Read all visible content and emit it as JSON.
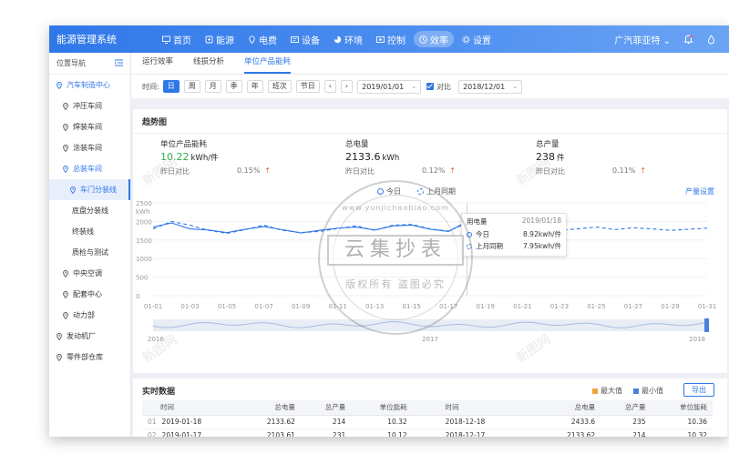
{
  "app": {
    "title": "能源管理系统",
    "nav": [
      {
        "label": "首页",
        "icon": "monitor-icon"
      },
      {
        "label": "能源",
        "icon": "energy-icon"
      },
      {
        "label": "电费",
        "icon": "location-icon"
      },
      {
        "label": "设备",
        "icon": "device-icon"
      },
      {
        "label": "环境",
        "icon": "pie-icon"
      },
      {
        "label": "控制",
        "icon": "control-icon"
      },
      {
        "label": "效率",
        "icon": "clock-icon"
      },
      {
        "label": "设置",
        "icon": "gear-icon"
      }
    ],
    "active_nav": "效率",
    "user": "广汽菲亚特"
  },
  "sidebar": {
    "title": "位置导航",
    "items": [
      {
        "label": "汽车制造中心",
        "level": "l0",
        "state": "blue"
      },
      {
        "label": "冲压车间",
        "level": "l1",
        "state": ""
      },
      {
        "label": "焊装车间",
        "level": "l1",
        "state": ""
      },
      {
        "label": "涂装车间",
        "level": "l1",
        "state": ""
      },
      {
        "label": "总装车间",
        "level": "l1",
        "state": "blue"
      },
      {
        "label": "车门分装线",
        "level": "l2",
        "state": "selected"
      },
      {
        "label": "底盘分装线",
        "level": "leaf",
        "state": ""
      },
      {
        "label": "终装线",
        "level": "leaf",
        "state": ""
      },
      {
        "label": "质检与测试",
        "level": "leaf",
        "state": ""
      },
      {
        "label": "中央空调",
        "level": "l1",
        "state": ""
      },
      {
        "label": "配套中心",
        "level": "l1",
        "state": ""
      },
      {
        "label": "动力部",
        "level": "l1",
        "state": ""
      },
      {
        "label": "发动机厂",
        "level": "l0",
        "state": ""
      },
      {
        "label": "零件部仓库",
        "level": "l0",
        "state": ""
      }
    ]
  },
  "tabs": [
    "运行效率",
    "线损分析",
    "单位产品能耗"
  ],
  "active_tab": "单位产品能耗",
  "filter": {
    "label": "时间:",
    "periods": [
      "日",
      "周",
      "月",
      "季",
      "年",
      "班次",
      "节日"
    ],
    "active_period": "日",
    "prev": "‹",
    "next": "›",
    "date": "2019/01/01",
    "compare_label": "对比",
    "compare_date": "2018/12/01",
    "caret": "⌄"
  },
  "trend": {
    "title": "趋势图",
    "kpis": [
      {
        "label": "单位产品能耗",
        "value": "10.22",
        "unit": "kWh/件",
        "compare_label": "昨日对比",
        "pct": "0.15%",
        "arrow": "↑",
        "green": true
      },
      {
        "label": "总电量",
        "value": "2133.6",
        "unit": "kWh",
        "compare_label": "昨日对比",
        "pct": "0.12%",
        "arrow": "↑",
        "green": false
      },
      {
        "label": "总产量",
        "value": "238",
        "unit": "件",
        "compare_label": "昨日对比",
        "pct": "0.11%",
        "arrow": "↑",
        "green": false
      }
    ],
    "legend_today": "今日",
    "legend_last": "上月同期",
    "settings_link": "产量设置",
    "tooltip": {
      "title": "用电量",
      "date": "2019/01/18",
      "rows": [
        {
          "label": "今日",
          "value": "8.92kwh/件"
        },
        {
          "label": "上月同期",
          "value": "7.95kwh/件"
        }
      ]
    },
    "brush_labels": [
      "2016",
      "2017",
      "2018"
    ]
  },
  "chart_data": {
    "type": "line",
    "ylabel": "kWh",
    "ylim": [
      0,
      2500
    ],
    "yticks": [
      0,
      500,
      1000,
      1500,
      2000,
      2500
    ],
    "x": [
      "01-01",
      "01-02",
      "01-03",
      "01-04",
      "01-05",
      "01-06",
      "01-07",
      "01-08",
      "01-09",
      "01-10",
      "01-11",
      "01-12",
      "01-13",
      "01-14",
      "01-15",
      "01-16",
      "01-17",
      "01-18",
      "01-19",
      "01-20",
      "01-21",
      "01-22",
      "01-23",
      "01-24",
      "01-25",
      "01-26",
      "01-27",
      "01-28",
      "01-29",
      "01-30",
      "01-31"
    ],
    "xtick_labels": [
      "01-01",
      "01-03",
      "01-05",
      "01-07",
      "01-09",
      "01-11",
      "01-13",
      "01-15",
      "01-17",
      "01-19",
      "01-21",
      "01-23",
      "01-25",
      "01-27",
      "01-29",
      "01-31"
    ],
    "series": [
      {
        "name": "今日",
        "style": "solid",
        "values": [
          1850,
          1960,
          1800,
          1770,
          1700,
          1790,
          1860,
          1780,
          1690,
          1760,
          1820,
          1850,
          1770,
          1880,
          1900,
          1790,
          1730,
          2000
        ]
      },
      {
        "name": "上月同期",
        "style": "dashed",
        "values": [
          1800,
          2000,
          1900,
          1760,
          1680,
          1780,
          1900,
          1760,
          1700,
          1730,
          1810,
          1880,
          1760,
          1900,
          1920,
          1800,
          1740,
          1960,
          1810,
          1790,
          1880,
          1820,
          1760,
          1800,
          1850,
          1780,
          1830,
          1800,
          1760,
          1790,
          1820
        ]
      }
    ],
    "highlight_index": 17,
    "colors": {
      "line": "#2f78e8",
      "grid": "#eef0f3",
      "axis": "#999999"
    }
  },
  "realtime": {
    "title": "实时数据",
    "legend_max": "最大值",
    "legend_min": "最小值",
    "color_max": "#f2a33a",
    "color_min": "#4a7fe0",
    "export": "导出",
    "headers": [
      "时间",
      "总电量",
      "总产量",
      "单位能耗",
      "时间",
      "总电量",
      "总产量",
      "单位能耗"
    ],
    "rows": [
      [
        "01",
        "2019-01-18",
        "2133.62",
        "214",
        "10.32",
        "2018-12-18",
        "2433.6",
        "235",
        "10.36"
      ],
      [
        "02",
        "2019-01-17",
        "2103.61",
        "231",
        "10.12",
        "2018-12-17",
        "2133.62",
        "214",
        "10.32"
      ]
    ]
  },
  "watermark": {
    "top": "www.yunjichaobiao.com",
    "main": "云集抄表",
    "bottom": "版权所有  盗图必究",
    "corner": "新图网"
  }
}
